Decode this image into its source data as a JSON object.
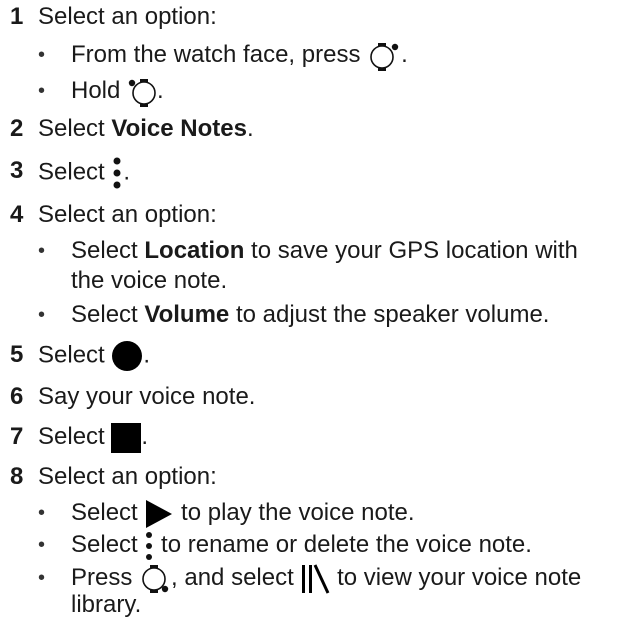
{
  "steps": [
    {
      "num": "1",
      "text": "Select an option:"
    },
    {
      "num": "2",
      "pre": "Select ",
      "bold": "Voice Notes",
      "post": "."
    },
    {
      "num": "3",
      "pre": "Select ",
      "icon": "menu-dots-icon",
      "post": "."
    },
    {
      "num": "4",
      "text": "Select an option:"
    },
    {
      "num": "5",
      "pre": "Select ",
      "icon": "record-circle-icon",
      "post": "."
    },
    {
      "num": "6",
      "text": "Say your voice note."
    },
    {
      "num": "7",
      "pre": "Select ",
      "icon": "stop-square-icon",
      "post": "."
    },
    {
      "num": "8",
      "text": "Select an option:"
    }
  ],
  "bullets": {
    "s1": [
      {
        "pre": "From the watch face, press ",
        "icon": "watch-button-top-right-icon",
        "post": "."
      },
      {
        "pre": "Hold ",
        "icon": "watch-button-top-left-icon",
        "post": "."
      }
    ],
    "s4": [
      {
        "pre": "Select ",
        "bold": "Location",
        "post": " to save your GPS location with",
        "cont": "the voice note."
      },
      {
        "pre": "Select ",
        "bold": "Volume",
        "post": " to adjust the speaker volume."
      }
    ],
    "s8": [
      {
        "pre": "Select ",
        "icon": "play-triangle-icon",
        "post": " to play the voice note."
      },
      {
        "pre": "Select ",
        "icon": "menu-dots-icon",
        "post": " to rename or delete the voice note."
      },
      {
        "pre": "Press ",
        "icon": "watch-button-bottom-right-icon",
        "mid": ", and select ",
        "icon2": "library-icon",
        "post": " to view your voice note",
        "cont": "library."
      }
    ]
  },
  "bullet_glyph": "•"
}
